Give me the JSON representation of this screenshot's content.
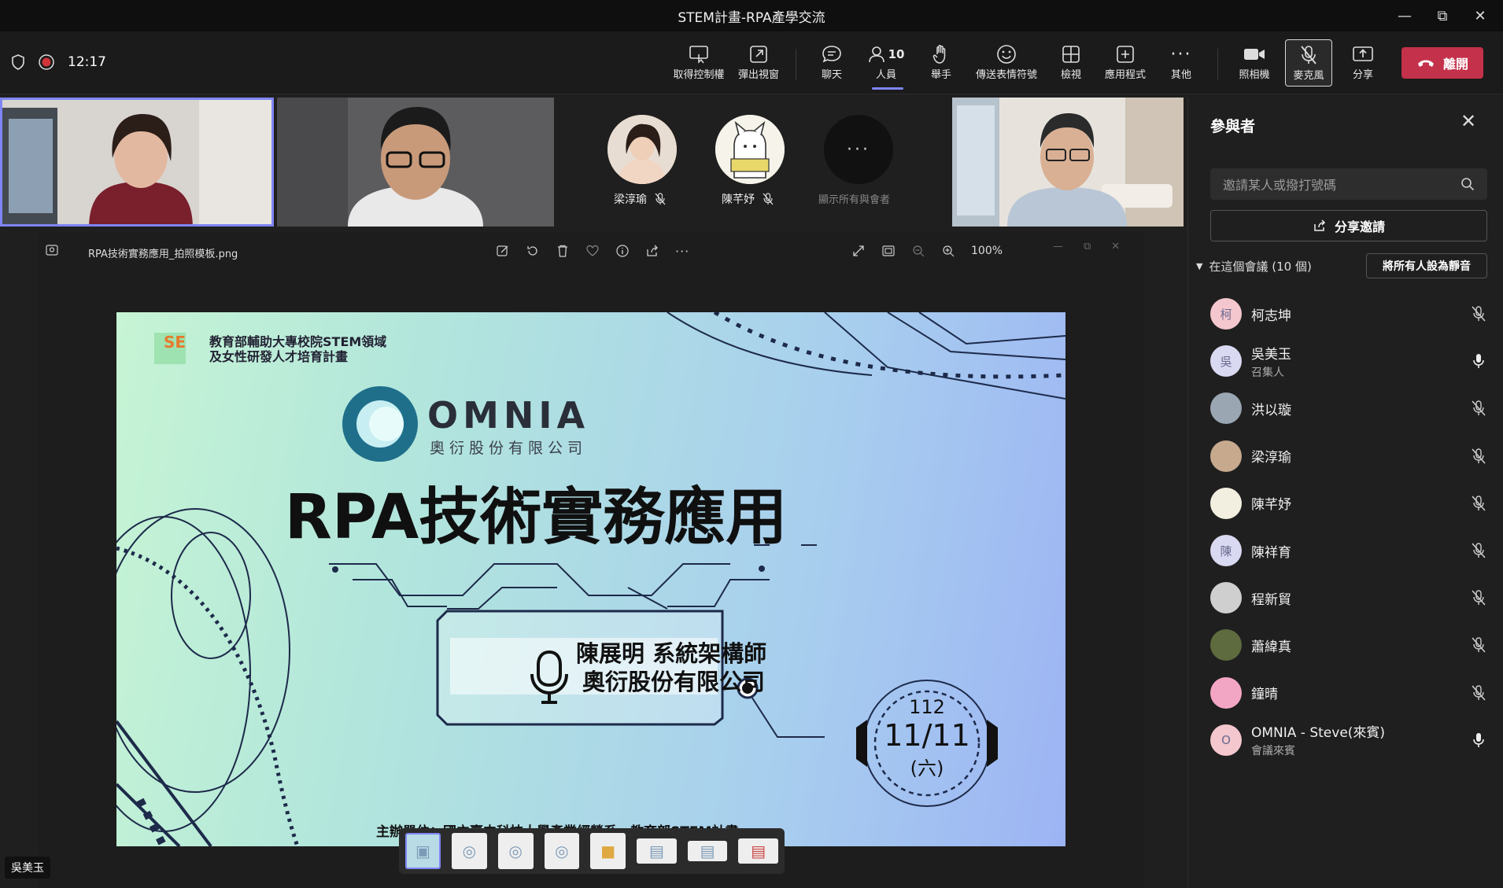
{
  "window": {
    "title": "STEM計畫-RPA產學交流"
  },
  "toolbar": {
    "timer": "12:17",
    "buttons": [
      {
        "label": "取得控制權"
      },
      {
        "label": "彈出視窗"
      },
      {
        "label": "聊天"
      },
      {
        "label": "人員",
        "count": "10"
      },
      {
        "label": "舉手"
      },
      {
        "label": "傳送表情符號"
      },
      {
        "label": "檢視"
      },
      {
        "label": "應用程式"
      },
      {
        "label": "其他"
      },
      {
        "label": "照相機"
      },
      {
        "label": "麥克風"
      },
      {
        "label": "分享"
      }
    ],
    "leave_label": "離開"
  },
  "gallery": {
    "avatars": [
      {
        "name": "梁淳瑜"
      },
      {
        "name": "陳芊妤"
      }
    ],
    "show_all_label": "顯示所有與會者"
  },
  "viewer": {
    "filename": "RPA技術實務應用_拍照模板.png",
    "zoom": "100%",
    "speaker_label": "吳美玉"
  },
  "slide": {
    "program_line1": "教育部輔助大專校院STEM領域",
    "program_line2": "及女性研發人才培育計畫",
    "company_en": "OMNIA",
    "company_zh": "奧衍股份有限公司",
    "title": "RPA技術實務應用",
    "speaker_line1": "陳展明 系統架構師",
    "speaker_line2": "奧衍股份有限公司",
    "date_year": "112",
    "date_md": "11/11",
    "date_weekday": "(六)",
    "footer": "主辦單位：國立臺中科技大學產業經營系、教育部STEM計畫"
  },
  "panel": {
    "title": "參與者",
    "search_placeholder": "邀請某人或撥打號碼",
    "share_invite": "分享邀請",
    "section": "在這個會議 (10 個)",
    "mute_all": "將所有人設為靜音",
    "participants": [
      {
        "name": "柯志坤",
        "initial": "柯",
        "avatar_color": "#f4c6cd",
        "muted": true
      },
      {
        "name": "吳美玉",
        "role": "召集人",
        "initial": "吳",
        "avatar_color": "#d9d9f2",
        "muted": false
      },
      {
        "name": "洪以璇",
        "initial": "",
        "avatar_color": "#9aa6b2",
        "muted": true
      },
      {
        "name": "梁淳瑜",
        "initial": "",
        "avatar_color": "#c7a98e",
        "muted": true
      },
      {
        "name": "陳芊妤",
        "initial": "",
        "avatar_color": "#f2eee0",
        "muted": true
      },
      {
        "name": "陳祥育",
        "initial": "陳",
        "avatar_color": "#d9d9f2",
        "muted": true
      },
      {
        "name": "程新貿",
        "initial": "",
        "avatar_color": "#cfcfcf",
        "muted": true
      },
      {
        "name": "蕭緯真",
        "initial": "",
        "avatar_color": "#5e6b3e",
        "muted": true
      },
      {
        "name": "鐘晴",
        "initial": "",
        "avatar_color": "#f3a6c4",
        "muted": true
      },
      {
        "name": "OMNIA - Steve(來賓)",
        "role": "會議來賓",
        "initial": "O",
        "avatar_color": "#f4c6cd",
        "muted": false
      }
    ]
  }
}
